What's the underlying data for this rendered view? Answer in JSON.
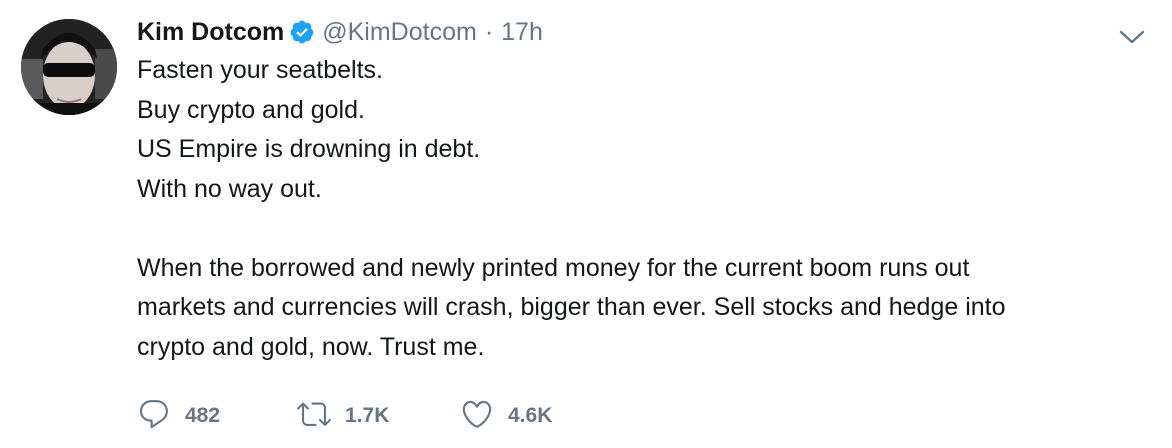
{
  "author": {
    "name": "Kim Dotcom",
    "handle": "@KimDotcom",
    "separator": "·",
    "time": "17h",
    "verified": true
  },
  "tweet": {
    "lines": [
      "Fasten your seatbelts.",
      "Buy crypto and gold.",
      "US Empire is drowning in debt.",
      "With no way out."
    ],
    "paragraph": [
      "When the borrowed and newly printed money for the current boom runs out",
      "markets and currencies will crash, bigger than ever. Sell stocks and hedge into",
      "crypto and gold, now. Trust me."
    ]
  },
  "actions": {
    "replies": "482",
    "retweets": "1.7K",
    "likes": "4.6K"
  },
  "colors": {
    "text": "#14171a",
    "secondary": "#657786",
    "verified_blue": "#1da1f2"
  },
  "icons": [
    "verified-badge-icon",
    "chevron-down-icon",
    "reply-icon",
    "retweet-icon",
    "like-icon"
  ]
}
